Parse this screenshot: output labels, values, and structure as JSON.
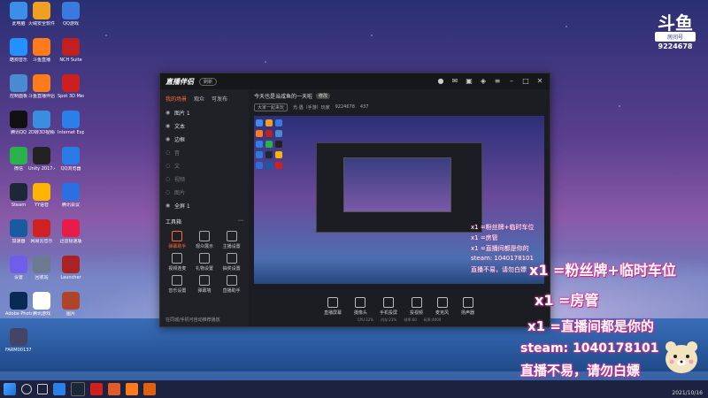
{
  "desktop": {
    "icons": [
      {
        "label": "此电脑",
        "color": "#3b8fe8"
      },
      {
        "label": "火绒安全软件",
        "color": "#f0a020"
      },
      {
        "label": "QQ游戏",
        "color": "#3a7adf"
      },
      {
        "label": "酷狗音乐",
        "color": "#2590ff"
      },
      {
        "label": "斗鱼直播",
        "color": "#ff7a1a"
      },
      {
        "label": "NCH Suite",
        "color": "#c02020"
      },
      {
        "label": "控制面板",
        "color": "#4a8ad0"
      },
      {
        "label": "斗鱼直播伴侣",
        "color": "#ff7a1a"
      },
      {
        "label": "Spot 3D Mesh C...",
        "color": "#cc2020"
      },
      {
        "label": "腾讯QQ",
        "color": "#111111"
      },
      {
        "label": "2D转3D视频(html)",
        "color": "#3a8ee0"
      },
      {
        "label": "Internet Explorer",
        "color": "#2a80e8"
      },
      {
        "label": "微信",
        "color": "#2ab24a"
      },
      {
        "label": "Unity 2017.4.12...",
        "color": "#222222"
      },
      {
        "label": "QQ浏览器",
        "color": "#2b7be6"
      },
      {
        "label": "Steam",
        "color": "#1b2838"
      },
      {
        "label": "YY语音",
        "color": "#ffb400"
      },
      {
        "label": "腾讯会议",
        "color": "#2a70e0"
      },
      {
        "label": "加速器",
        "color": "#1a5aa0"
      },
      {
        "label": "网易云音乐",
        "color": "#d02020"
      },
      {
        "label": "迅雷极速版",
        "color": "#e81c4a"
      },
      {
        "label": "设置",
        "color": "#6f5fe8"
      },
      {
        "label": "回收站",
        "color": "#6a7a90"
      },
      {
        "label": "Launcher",
        "color": "#aa2222"
      },
      {
        "label": "Adobe Photosh...",
        "color": "#0a2a55"
      },
      {
        "label": "腾讯游戏",
        "color": "#ffffff"
      },
      {
        "label": "图片",
        "color": "#b0442a"
      },
      {
        "label": "FARM00137...",
        "color": "#444466"
      }
    ]
  },
  "douyu": {
    "logo": "斗鱼",
    "tag": "房间号",
    "room_id": "9224678"
  },
  "app": {
    "title": "直播伴侣",
    "badge": "刷新",
    "tabs": [
      "我的场景",
      "观众",
      "可发布"
    ],
    "scenes": [
      {
        "name": "图片 1"
      },
      {
        "name": "文本"
      },
      {
        "name": "边框"
      },
      {
        "name": "音"
      },
      {
        "name": "文"
      },
      {
        "name": "视频"
      },
      {
        "name": "图片"
      },
      {
        "name": "全屏 1"
      }
    ],
    "tools_title": "工具箱",
    "tools": [
      {
        "label": "弹幕助手"
      },
      {
        "label": "观众展示"
      },
      {
        "label": "主播设置"
      },
      {
        "label": "视频连麦"
      },
      {
        "label": "礼物设置"
      },
      {
        "label": "抽奖设置"
      },
      {
        "label": "音乐设置"
      },
      {
        "label": "弹幕墙"
      },
      {
        "label": "直播助手"
      }
    ],
    "left_bottom": "在同城/手机可自动推荐播放",
    "stream_title": "今天也是当咸鱼的一天啦",
    "stream_chip": "修改",
    "info": {
      "category": "大家一起来玩",
      "name": "光·遇（手游）玩家",
      "room": "9224678",
      "viewers": "437"
    },
    "bottom_actions": [
      "直播屏幕",
      "摄像头",
      "手机投屏",
      "投视频",
      "麦克风",
      "扬声器"
    ],
    "status": [
      "CPU:32%",
      "内存:23%",
      "帧率:60",
      "码率:4000"
    ]
  },
  "overlay": {
    "lines": [
      "x1 =粉丝牌+临时车位",
      "x1 =房管",
      "x1 =直播间都是你的",
      "steam: 1040178101",
      "直播不易，请勿白嫖"
    ],
    "small_lines": [
      "x1 =粉丝牌+临时车位",
      "x1 =房管",
      "x1 =直播间都是你的",
      "steam: 1040178101",
      "直播不易，请勿白嫖"
    ]
  },
  "taskbar": {
    "clock_time": "",
    "clock_date": "2021/10/16"
  }
}
